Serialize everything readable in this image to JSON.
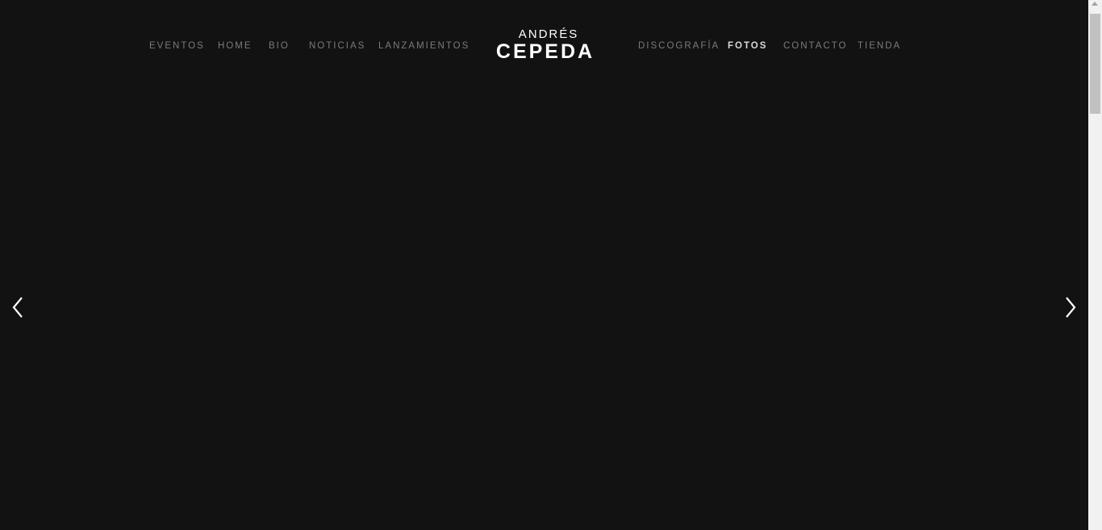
{
  "nav": {
    "left": [
      "EVENTOS",
      "HOME",
      "BIO",
      "NOTICIAS",
      "LANZAMIENTOS"
    ],
    "right": [
      "DISCOGRAFÍA",
      "FOTOS",
      "CONTACTO",
      "TIENDA"
    ],
    "active": "FOTOS"
  },
  "logo": {
    "top": "ANDRÉS",
    "bottom": "CEPEDA"
  },
  "slider": {
    "prev_icon": "chevron-left-icon",
    "next_icon": "chevron-right-icon"
  },
  "colors": {
    "background": "#121212",
    "nav_text": "#7b7b7b",
    "nav_active": "#d8d8d8",
    "logo": "#ffffff"
  }
}
